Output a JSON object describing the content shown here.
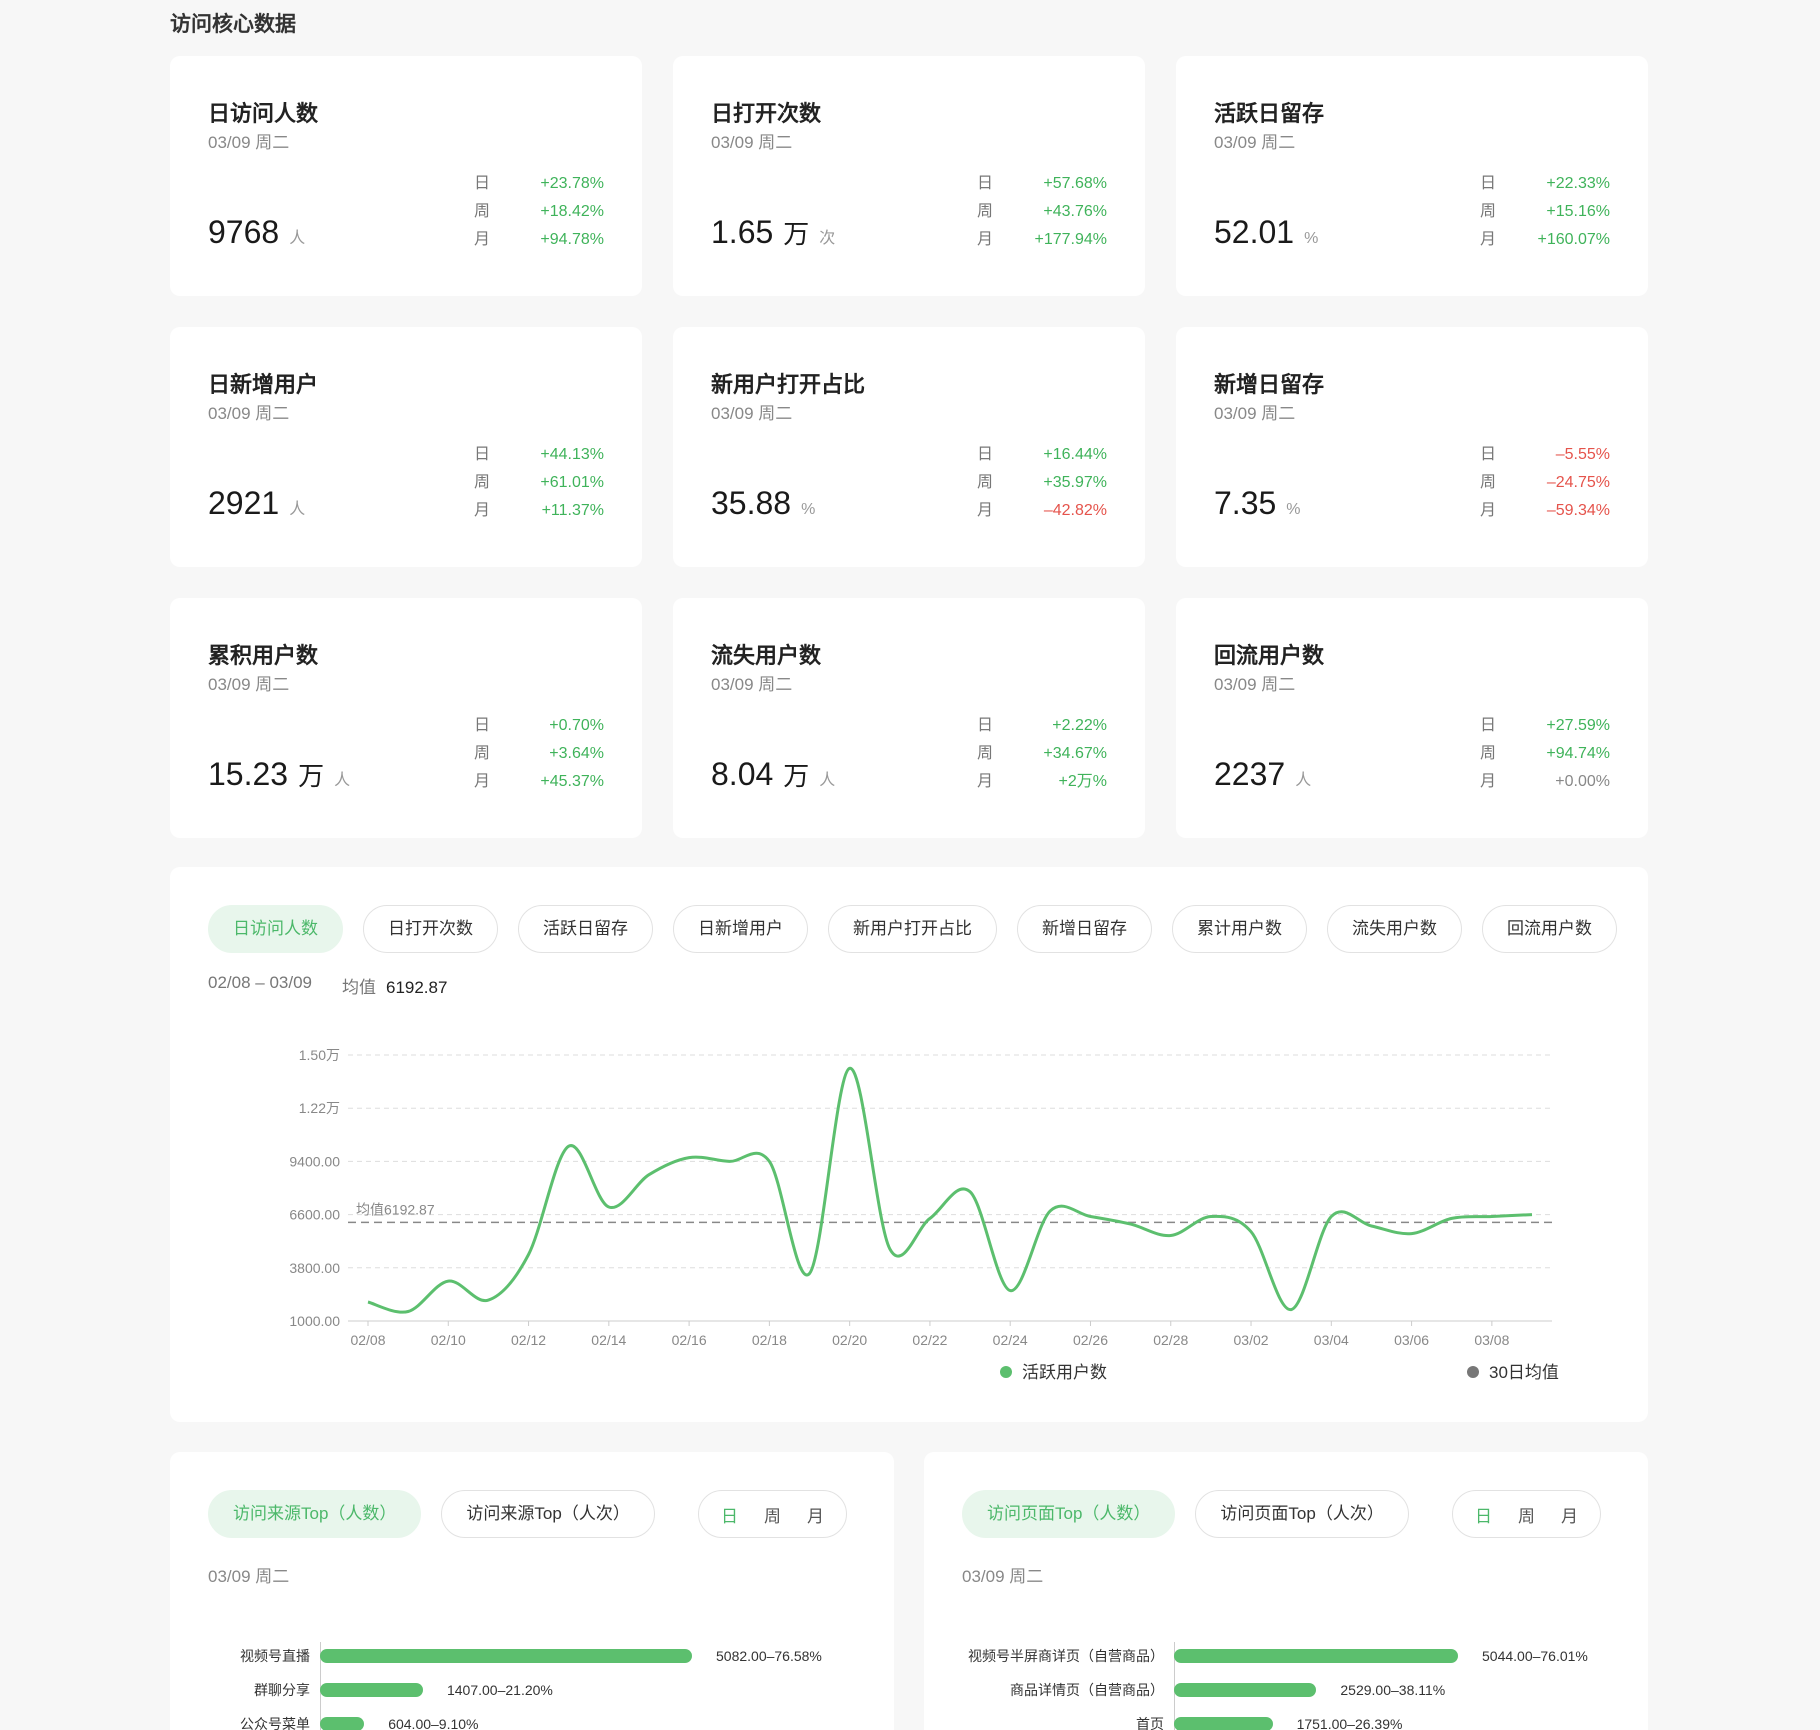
{
  "section_title": "访问核心数据",
  "metrics": [
    {
      "title": "日访问人数",
      "date": "03/09 周二",
      "value": "9768",
      "unit1": "",
      "unit2": "人",
      "changes": [
        {
          "label": "日",
          "value": "+23.78%",
          "trend": "up"
        },
        {
          "label": "周",
          "value": "+18.42%",
          "trend": "up"
        },
        {
          "label": "月",
          "value": "+94.78%",
          "trend": "up"
        }
      ]
    },
    {
      "title": "日打开次数",
      "date": "03/09 周二",
      "value": "1.65",
      "unit1": "万",
      "unit2": "次",
      "changes": [
        {
          "label": "日",
          "value": "+57.68%",
          "trend": "up"
        },
        {
          "label": "周",
          "value": "+43.76%",
          "trend": "up"
        },
        {
          "label": "月",
          "value": "+177.94%",
          "trend": "up"
        }
      ]
    },
    {
      "title": "活跃日留存",
      "date": "03/09 周二",
      "value": "52.01",
      "unit1": "",
      "unit2": "%",
      "changes": [
        {
          "label": "日",
          "value": "+22.33%",
          "trend": "up"
        },
        {
          "label": "周",
          "value": "+15.16%",
          "trend": "up"
        },
        {
          "label": "月",
          "value": "+160.07%",
          "trend": "up"
        }
      ]
    },
    {
      "title": "日新增用户",
      "date": "03/09 周二",
      "value": "2921",
      "unit1": "",
      "unit2": "人",
      "changes": [
        {
          "label": "日",
          "value": "+44.13%",
          "trend": "up"
        },
        {
          "label": "周",
          "value": "+61.01%",
          "trend": "up"
        },
        {
          "label": "月",
          "value": "+11.37%",
          "trend": "up"
        }
      ]
    },
    {
      "title": "新用户打开占比",
      "date": "03/09 周二",
      "value": "35.88",
      "unit1": "",
      "unit2": "%",
      "changes": [
        {
          "label": "日",
          "value": "+16.44%",
          "trend": "up"
        },
        {
          "label": "周",
          "value": "+35.97%",
          "trend": "up"
        },
        {
          "label": "月",
          "value": "–42.82%",
          "trend": "down"
        }
      ]
    },
    {
      "title": "新增日留存",
      "date": "03/09 周二",
      "value": "7.35",
      "unit1": "",
      "unit2": "%",
      "changes": [
        {
          "label": "日",
          "value": "–5.55%",
          "trend": "down"
        },
        {
          "label": "周",
          "value": "–24.75%",
          "trend": "down"
        },
        {
          "label": "月",
          "value": "–59.34%",
          "trend": "down"
        }
      ]
    },
    {
      "title": "累积用户数",
      "date": "03/09 周二",
      "value": "15.23",
      "unit1": "万",
      "unit2": "人",
      "changes": [
        {
          "label": "日",
          "value": "+0.70%",
          "trend": "up"
        },
        {
          "label": "周",
          "value": "+3.64%",
          "trend": "up"
        },
        {
          "label": "月",
          "value": "+45.37%",
          "trend": "up"
        }
      ]
    },
    {
      "title": "流失用户数",
      "date": "03/09 周二",
      "value": "8.04",
      "unit1": "万",
      "unit2": "人",
      "changes": [
        {
          "label": "日",
          "value": "+2.22%",
          "trend": "up"
        },
        {
          "label": "周",
          "value": "+34.67%",
          "trend": "up"
        },
        {
          "label": "月",
          "value": "+2万%",
          "trend": "up"
        }
      ]
    },
    {
      "title": "回流用户数",
      "date": "03/09 周二",
      "value": "2237",
      "unit1": "",
      "unit2": "人",
      "changes": [
        {
          "label": "日",
          "value": "+27.59%",
          "trend": "up"
        },
        {
          "label": "周",
          "value": "+94.74%",
          "trend": "up"
        },
        {
          "label": "月",
          "value": "+0.00%",
          "trend": "neutral"
        }
      ]
    }
  ],
  "chart_tabs": [
    "日访问人数",
    "日打开次数",
    "活跃日留存",
    "日新增用户",
    "新用户打开占比",
    "新增日留存",
    "累计用户数",
    "流失用户数",
    "回流用户数"
  ],
  "chart_tab_active": 0,
  "chart_range": "02/08 – 03/09",
  "chart_avg_label": "均值",
  "chart_avg_value": "6192.87",
  "colors": {
    "accent": "#5cbf6e",
    "accent_bg": "#e8f6ec",
    "down": "#e5534b",
    "avg_line": "#888888"
  },
  "chart_data": {
    "type": "line",
    "x": [
      "02/08",
      "02/09",
      "02/10",
      "02/11",
      "02/12",
      "02/13",
      "02/14",
      "02/15",
      "02/16",
      "02/17",
      "02/18",
      "02/19",
      "02/20",
      "02/21",
      "02/22",
      "02/23",
      "02/24",
      "02/25",
      "02/26",
      "02/27",
      "02/28",
      "03/01",
      "03/02",
      "03/03",
      "03/04",
      "03/05",
      "03/06",
      "03/07",
      "03/08",
      "03/09"
    ],
    "x_tick_labels": [
      "02/08",
      "02/10",
      "02/12",
      "02/14",
      "02/16",
      "02/18",
      "02/20",
      "02/22",
      "02/24",
      "02/26",
      "02/28",
      "03/02",
      "03/04",
      "03/06",
      "03/08"
    ],
    "y_tick_labels": [
      "1000.00",
      "3800.00",
      "6600.00",
      "9400.00",
      "1.22万",
      "1.50万"
    ],
    "y_ticks": [
      1000,
      3800,
      6600,
      9400,
      12200,
      15000
    ],
    "ylim": [
      1000,
      15000
    ],
    "series": [
      {
        "name": "活跃用户数",
        "values": [
          2000,
          1500,
          3100,
          2100,
          4500,
          10200,
          7000,
          8700,
          9600,
          9400,
          9400,
          3500,
          14300,
          4800,
          6400,
          7800,
          2600,
          6800,
          6500,
          6100,
          5500,
          6500,
          5700,
          1600,
          6500,
          6000,
          5600,
          6400,
          6500,
          6600
        ]
      }
    ],
    "average": {
      "name": "30日均值",
      "value": 6192.87,
      "label": "均值6192.87"
    },
    "legend": [
      "活跃用户数",
      "30日均值"
    ],
    "grid": true
  },
  "source_card": {
    "tabs": [
      "访问来源Top（人数）",
      "访问来源Top（人次）"
    ],
    "active": 0,
    "periods": [
      "日",
      "周",
      "月"
    ],
    "period_active": 0,
    "date": "03/09 周二",
    "chart_data": {
      "type": "bar",
      "categories": [
        "视频号直播",
        "群聊分享",
        "公众号菜单"
      ],
      "values": [
        5082.0,
        1407.0,
        604.0
      ],
      "value_labels": [
        "5082.00–76.58%",
        "1407.00–21.20%",
        "604.00–9.10%"
      ]
    }
  },
  "page_card": {
    "tabs": [
      "访问页面Top（人数）",
      "访问页面Top（人次）"
    ],
    "active": 0,
    "periods": [
      "日",
      "周",
      "月"
    ],
    "period_active": 0,
    "date": "03/09 周二",
    "chart_data": {
      "type": "bar",
      "categories": [
        "视频号半屏商详页（自营商品）",
        "商品详情页（自营商品）",
        "首页"
      ],
      "values": [
        5044.0,
        2529.0,
        1751.0
      ],
      "value_labels": [
        "5044.00–76.01%",
        "2529.00–38.11%",
        "1751.00–26.39%"
      ]
    }
  }
}
